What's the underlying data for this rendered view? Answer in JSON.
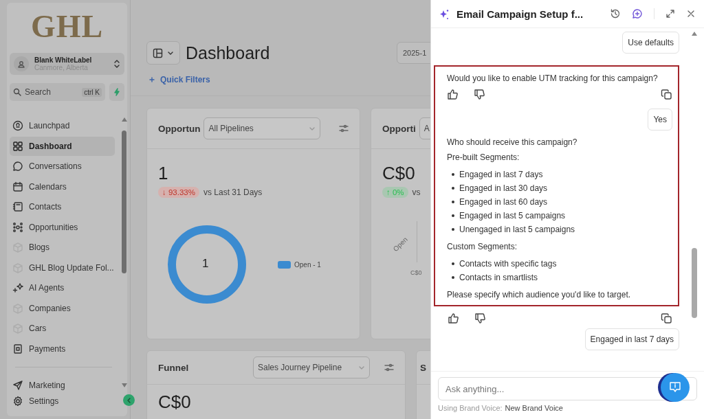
{
  "sidebar": {
    "logo": "GHL",
    "account": {
      "name": "Blank WhiteLabel",
      "location": "Canmore, Alberta"
    },
    "search": {
      "placeholder": "Search",
      "shortcut": "ctrl K"
    },
    "nav_items": [
      {
        "label": "Launchpad",
        "selected": false
      },
      {
        "label": "Dashboard",
        "selected": true
      },
      {
        "label": "Conversations",
        "selected": false
      },
      {
        "label": "Calendars",
        "selected": false
      },
      {
        "label": "Contacts",
        "selected": false
      },
      {
        "label": "Opportunities",
        "selected": false
      },
      {
        "label": "Blogs",
        "selected": false
      },
      {
        "label": "GHL Blog Update Fol...",
        "selected": false
      },
      {
        "label": "AI Agents",
        "selected": false
      },
      {
        "label": "Companies",
        "selected": false
      },
      {
        "label": "Cars",
        "selected": false
      },
      {
        "label": "Payments",
        "selected": false
      }
    ],
    "bottom_items": [
      {
        "label": "Marketing",
        "selected": false
      },
      {
        "label": "Settings",
        "selected": false
      }
    ]
  },
  "main": {
    "title": "Dashboard",
    "date": "2025-1",
    "quick_filters": "Quick Filters",
    "cards": [
      {
        "title": "Opportun",
        "dropdown": "All Pipelines",
        "value": "1",
        "change": {
          "text": "↓ 93.33%",
          "color": "#d6b1ae"
        },
        "comparison": "vs Last 31 Days",
        "center_label": "1",
        "legend": "Open - 1"
      },
      {
        "title": "Opporti",
        "dropdown": "A",
        "value": "C$0",
        "change": {
          "text": "↑ 0%",
          "color": "#a9c7b1"
        },
        "comparison": "vs",
        "axis_labels": [
          "Open",
          "C$0"
        ]
      },
      {
        "title": "Funnel",
        "dropdown": "Sales Journey Pipeline",
        "value": "C$0"
      },
      {
        "title": "S"
      }
    ]
  },
  "chat": {
    "title": "Email Campaign Setup f...",
    "messages": [
      {
        "kind": "user",
        "text": "Use defaults",
        "highlighted": false
      },
      {
        "kind": "assistant",
        "highlighted": true,
        "blocks": [
          {
            "kind": "text",
            "text": "Would you like to enable UTM tracking for this campaign?"
          }
        ]
      },
      {
        "kind": "user",
        "text": "Yes",
        "highlighted": true
      },
      {
        "kind": "assistant",
        "highlighted": true,
        "blocks": [
          {
            "kind": "text",
            "text": "Who should receive this campaign?"
          },
          {
            "kind": "text",
            "text": "Pre-built Segments:"
          },
          {
            "kind": "list",
            "items": [
              "Engaged in last 7 days",
              "Engaged in last 30 days",
              "Engaged in last 60 days",
              "Engaged in last 5 campaigns",
              "Unengaged in last 5 campaigns"
            ]
          },
          {
            "kind": "text",
            "text": "Custom Segments:"
          },
          {
            "kind": "list",
            "items": [
              "Contacts with specific tags",
              "Contacts in smartlists"
            ]
          },
          {
            "kind": "text",
            "text": "Please specify which audience you'd like to target."
          }
        ]
      },
      {
        "kind": "user",
        "text": "Engaged in last 7 days",
        "highlighted": false
      }
    ],
    "input": {
      "placeholder": "Ask anything..."
    },
    "brand_voice": {
      "label": "Using Brand Voice:",
      "value": "New Brand Voice"
    }
  }
}
